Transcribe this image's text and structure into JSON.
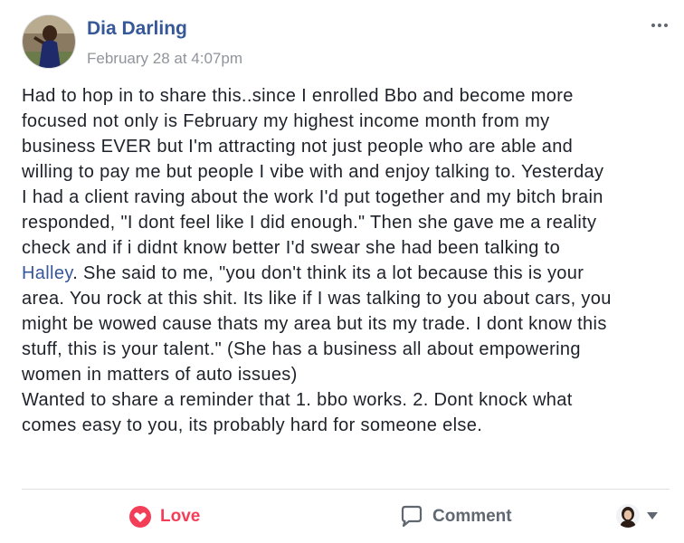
{
  "post": {
    "author": "Dia Darling",
    "timestamp": "February 28 at 4:07pm",
    "menu_icon": "more-options-icon",
    "body_lines": [
      "Had to hop in to share this..since I enrolled Bbo and become more",
      "focused not only is February my highest income month from my",
      "business EVER but I'm attracting not just people who are able and",
      "willing to pay me but people I vibe with and enjoy talking to. Yesterday",
      "I had a client raving about the work I'd put together and my bitch brain",
      "responded, \"I dont feel like I did enough.\" Then she gave me a reality",
      "check and if i didnt know better I'd swear she had been talking to"
    ],
    "mention": "Halley",
    "mention_line_rest": ". She said to me, \"you don't think its a lot because this is your",
    "body_lines_after": [
      "area. You rock at this shit. Its like if I was talking to you about cars, you",
      "might be wowed cause thats my area but its my trade. I dont know this",
      "stuff, this is your talent.\" (She has a business all about empowering",
      "women in matters of auto issues)",
      "Wanted to share a reminder that 1. bbo works. 2. Dont knock what",
      "comes easy to you, its probably hard for someone else."
    ]
  },
  "actions": {
    "love_label": "Love",
    "comment_label": "Comment"
  },
  "colors": {
    "author": "#365899",
    "timestamp": "#90949c",
    "love": "#f33e58",
    "action": "#606770",
    "divider": "#dddfe2"
  }
}
